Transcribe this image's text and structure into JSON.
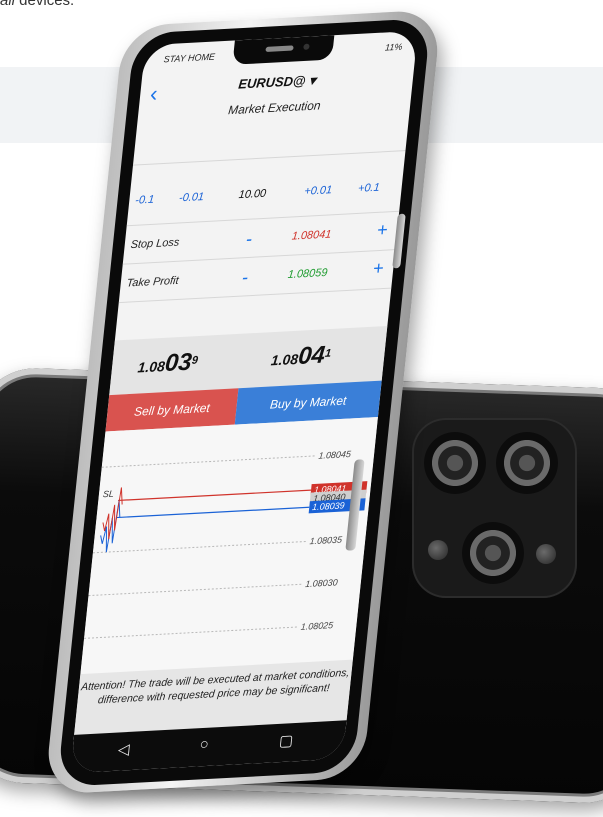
{
  "caption": {
    "prefix": "",
    "italic": "all",
    "rest": " devices."
  },
  "status_bar": {
    "carrier": "STAY HOME",
    "battery": "11%"
  },
  "header": {
    "back_icon": "chevron-left-icon",
    "symbol": "EURUSD@ ▾",
    "execution_type": "Market Execution"
  },
  "volume": {
    "minus_01": "-0.1",
    "minus_001": "-0.01",
    "value": "10.00",
    "plus_001": "+0.01",
    "plus_01": "+0.1"
  },
  "stop_loss": {
    "label": "Stop Loss",
    "minus": "-",
    "value": "1.08041",
    "plus": "+"
  },
  "take_profit": {
    "label": "Take Profit",
    "minus": "-",
    "value": "1.08059",
    "plus": "+"
  },
  "prices": {
    "bid_prefix": "1.08",
    "bid_big": "03",
    "bid_sup": "9",
    "ask_prefix": "1.08",
    "ask_big": "04",
    "ask_sup": "1"
  },
  "buttons": {
    "sell": "Sell by Market",
    "buy": "Buy by Market"
  },
  "chart_data": {
    "type": "line",
    "y_ticks": [
      "1.08045",
      "1.08035",
      "1.08030",
      "1.08025"
    ],
    "level_labels": [
      "1.08041",
      "1.08040",
      "1.08039"
    ],
    "sl_label": "SL",
    "series": [
      {
        "values": [
          1.08037,
          1.08036,
          1.08038,
          1.08035,
          1.08039,
          1.08036,
          1.08041,
          1.08039
        ]
      }
    ],
    "ylim": [
      1.08022,
      1.08048
    ],
    "colors": {
      "sl": "#d0332b",
      "price": "#1a62d6",
      "grid": "#b8b8b8"
    }
  },
  "warning": {
    "text": "Attention! The trade will be executed at market conditions, difference with requested price may be significant!"
  },
  "navbar": {
    "back": "◁",
    "home": "○",
    "recents": "▢"
  }
}
